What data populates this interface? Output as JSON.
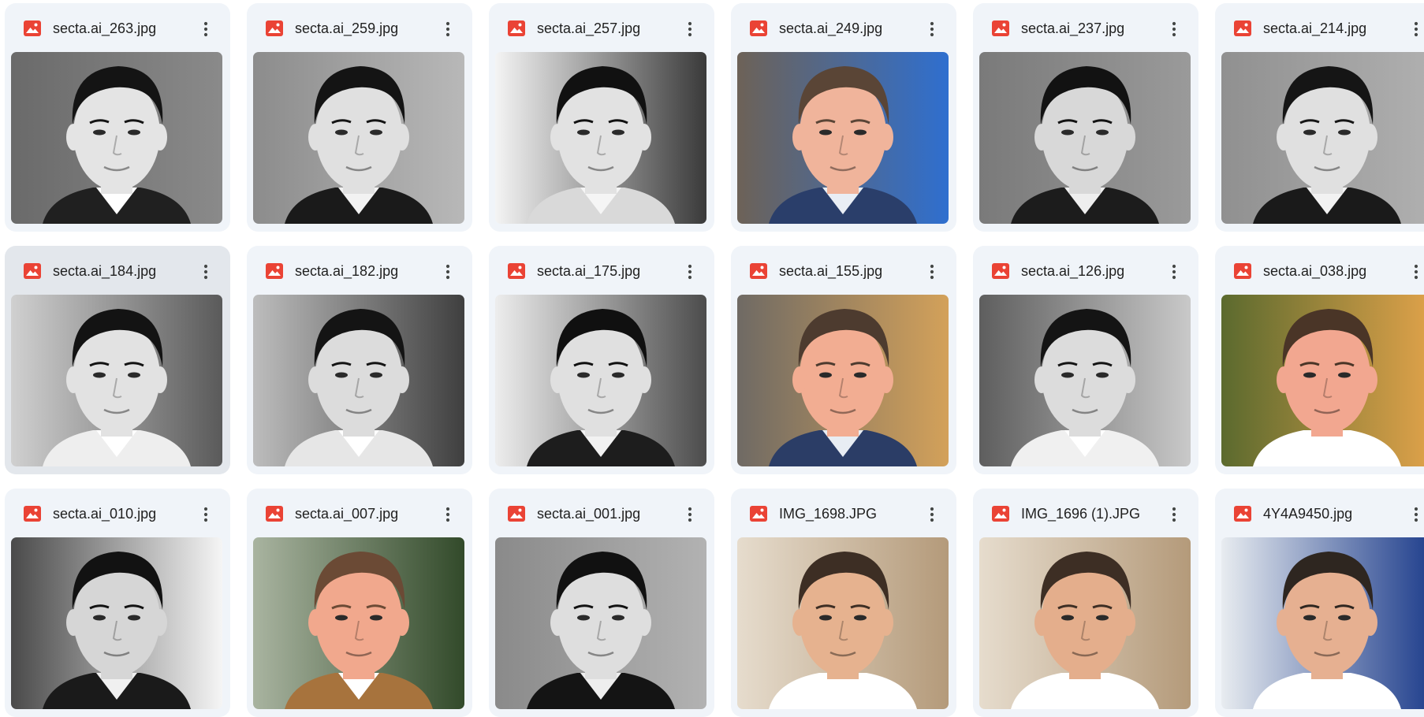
{
  "colors": {
    "card_bg": "#f0f4f9",
    "card_selected_bg": "#e3e7ec",
    "image_icon": "#ea4335",
    "text": "#1f1f1f",
    "more_dots": "#444746"
  },
  "icons": {
    "file_type": "image-file-icon",
    "more": "more-vert-icon"
  },
  "files": [
    {
      "name": "secta.ai_263.jpg",
      "selected": false,
      "photo": {
        "bg": [
          "#6a6a6a",
          "#8a8a8a"
        ],
        "skin": "#e4e4e4",
        "hair": "#141414",
        "shirt": "#202020",
        "collar": "#ffffff",
        "color": false
      }
    },
    {
      "name": "secta.ai_259.jpg",
      "selected": false,
      "photo": {
        "bg": [
          "#8c8c8c",
          "#b8b8b8"
        ],
        "skin": "#e0e0e0",
        "hair": "#141414",
        "shirt": "#1a1a1a",
        "collar": "#f2f2f2",
        "color": false
      }
    },
    {
      "name": "secta.ai_257.jpg",
      "selected": false,
      "photo": {
        "bg": [
          "#f4f4f4",
          "#3a3a3a"
        ],
        "skin": "#e2e2e2",
        "hair": "#111111",
        "shirt": "#d9d9d9",
        "collar": "#f5f5f5",
        "color": false
      }
    },
    {
      "name": "secta.ai_249.jpg",
      "selected": false,
      "photo": {
        "bg": [
          "#6d6257",
          "#2f6fcf"
        ],
        "skin": "#f0b49b",
        "hair": "#5a4536",
        "shirt": "#2a3e6a",
        "collar": "#e9eef5",
        "color": true
      }
    },
    {
      "name": "secta.ai_237.jpg",
      "selected": false,
      "photo": {
        "bg": [
          "#7a7a7a",
          "#9a9a9a"
        ],
        "skin": "#d8d8d8",
        "hair": "#121212",
        "shirt": "#1c1c1c",
        "collar": "#eeeeee",
        "color": false
      }
    },
    {
      "name": "secta.ai_214.jpg",
      "selected": false,
      "photo": {
        "bg": [
          "#909090",
          "#b0b0b0"
        ],
        "skin": "#e0e0e0",
        "hair": "#151515",
        "shirt": "#1a1a1a",
        "collar": "#f2f2f2",
        "color": false
      }
    },
    {
      "name": "secta.ai_184.jpg",
      "selected": true,
      "photo": {
        "bg": [
          "#d0d0d0",
          "#5a5a5a"
        ],
        "skin": "#e2e2e2",
        "hair": "#131313",
        "shirt": "#eeeeee",
        "collar": "#ffffff",
        "color": false
      }
    },
    {
      "name": "secta.ai_182.jpg",
      "selected": false,
      "photo": {
        "bg": [
          "#bdbdbd",
          "#3f3f3f"
        ],
        "skin": "#dcdcdc",
        "hair": "#141414",
        "shirt": "#e6e6e6",
        "collar": "#ffffff",
        "color": false
      }
    },
    {
      "name": "secta.ai_175.jpg",
      "selected": false,
      "photo": {
        "bg": [
          "#ededed",
          "#4c4c4c"
        ],
        "skin": "#e0e0e0",
        "hair": "#101010",
        "shirt": "#1d1d1d",
        "collar": "#f2f2f2",
        "color": false
      }
    },
    {
      "name": "secta.ai_155.jpg",
      "selected": false,
      "photo": {
        "bg": [
          "#6f6a64",
          "#d3a15a"
        ],
        "skin": "#f2ad92",
        "hair": "#4d3b2f",
        "shirt": "#2b3d66",
        "collar": "#e8edf3",
        "color": true
      }
    },
    {
      "name": "secta.ai_126.jpg",
      "selected": false,
      "photo": {
        "bg": [
          "#5e5e5e",
          "#c9c9c9"
        ],
        "skin": "#dcdcdc",
        "hair": "#141414",
        "shirt": "#f0f0f0",
        "collar": "#ffffff",
        "color": false
      }
    },
    {
      "name": "secta.ai_038.jpg",
      "selected": false,
      "photo": {
        "bg": [
          "#5b6a2e",
          "#e0a24a"
        ],
        "skin": "#f2a790",
        "hair": "#4a3527",
        "shirt": "#ffffff",
        "collar": "#ffffff",
        "color": true
      }
    },
    {
      "name": "secta.ai_010.jpg",
      "selected": false,
      "photo": {
        "bg": [
          "#4a4a4a",
          "#f5f5f5"
        ],
        "skin": "#d6d6d6",
        "hair": "#121212",
        "shirt": "#1a1a1a",
        "collar": "#f0f0f0",
        "color": false
      }
    },
    {
      "name": "secta.ai_007.jpg",
      "selected": false,
      "photo": {
        "bg": [
          "#a9b4a0",
          "#324a2a"
        ],
        "skin": "#f1a88d",
        "hair": "#6b4a35",
        "shirt": "#a7733d",
        "collar": "#ffffff",
        "color": true
      }
    },
    {
      "name": "secta.ai_001.jpg",
      "selected": false,
      "photo": {
        "bg": [
          "#8a8a8a",
          "#b2b2b2"
        ],
        "skin": "#dedede",
        "hair": "#111111",
        "shirt": "#141414",
        "collar": "#eeeeee",
        "color": false
      }
    },
    {
      "name": "IMG_1698.JPG",
      "selected": false,
      "photo": {
        "bg": [
          "#e6dccd",
          "#b49a7a"
        ],
        "skin": "#e6b28f",
        "hair": "#3d2e24",
        "shirt": "#ffffff",
        "collar": "#ffffff",
        "color": true
      }
    },
    {
      "name": "IMG_1696 (1).JPG",
      "selected": false,
      "photo": {
        "bg": [
          "#e6dccd",
          "#b49a7a"
        ],
        "skin": "#e4ae8c",
        "hair": "#3d2e24",
        "shirt": "#ffffff",
        "collar": "#ffffff",
        "color": true
      }
    },
    {
      "name": "4Y4A9450.jpg",
      "selected": false,
      "photo": {
        "bg": [
          "#e8ecf0",
          "#1f3e8c"
        ],
        "skin": "#e6b091",
        "hair": "#2e2620",
        "shirt": "#ffffff",
        "collar": "#ffffff",
        "color": true
      }
    }
  ]
}
